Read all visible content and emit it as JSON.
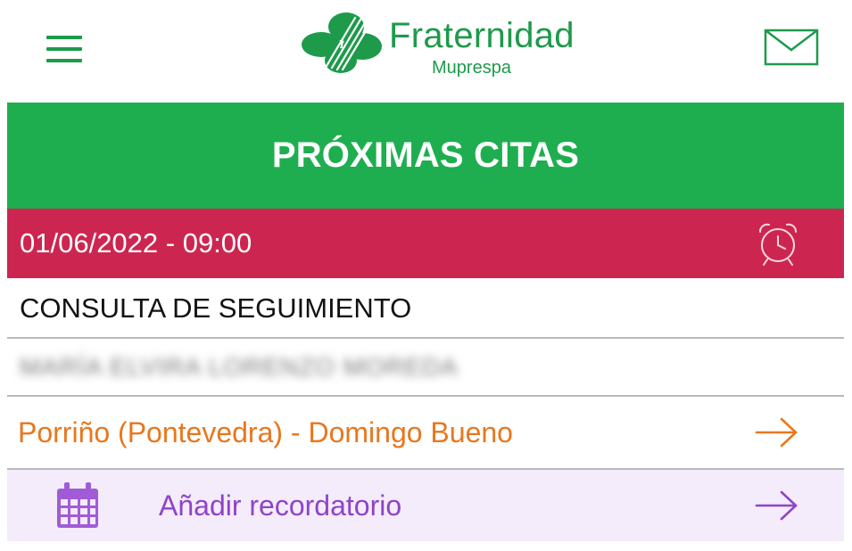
{
  "header": {
    "menu_icon": "hamburger-menu-icon",
    "logo_icon": "fraternidad-clover-logo-icon",
    "logo_title": "Fraternidad",
    "logo_subtitle": "Muprespa",
    "mail_icon": "envelope-icon"
  },
  "banner": {
    "title": "PRÓXIMAS CITAS"
  },
  "appointment": {
    "datetime": "01/06/2022 - 09:00",
    "alarm_icon": "alarm-clock-icon",
    "type": "CONSULTA DE SEGUIMIENTO",
    "doctor": "MARÍA ELVIRA LORENZO MOREDA",
    "location": "Porriño (Pontevedra) - Domingo Bueno",
    "location_arrow_icon": "arrow-right-icon"
  },
  "reminder": {
    "calendar_icon": "calendar-icon",
    "label": "Añadir recordatorio",
    "arrow_icon": "arrow-right-icon"
  },
  "colors": {
    "brand_green": "#1fae4f",
    "date_red": "#cc2650",
    "location_orange": "#e8771e",
    "reminder_purple": "#8e44c8",
    "reminder_bg": "#f4ebfb"
  }
}
